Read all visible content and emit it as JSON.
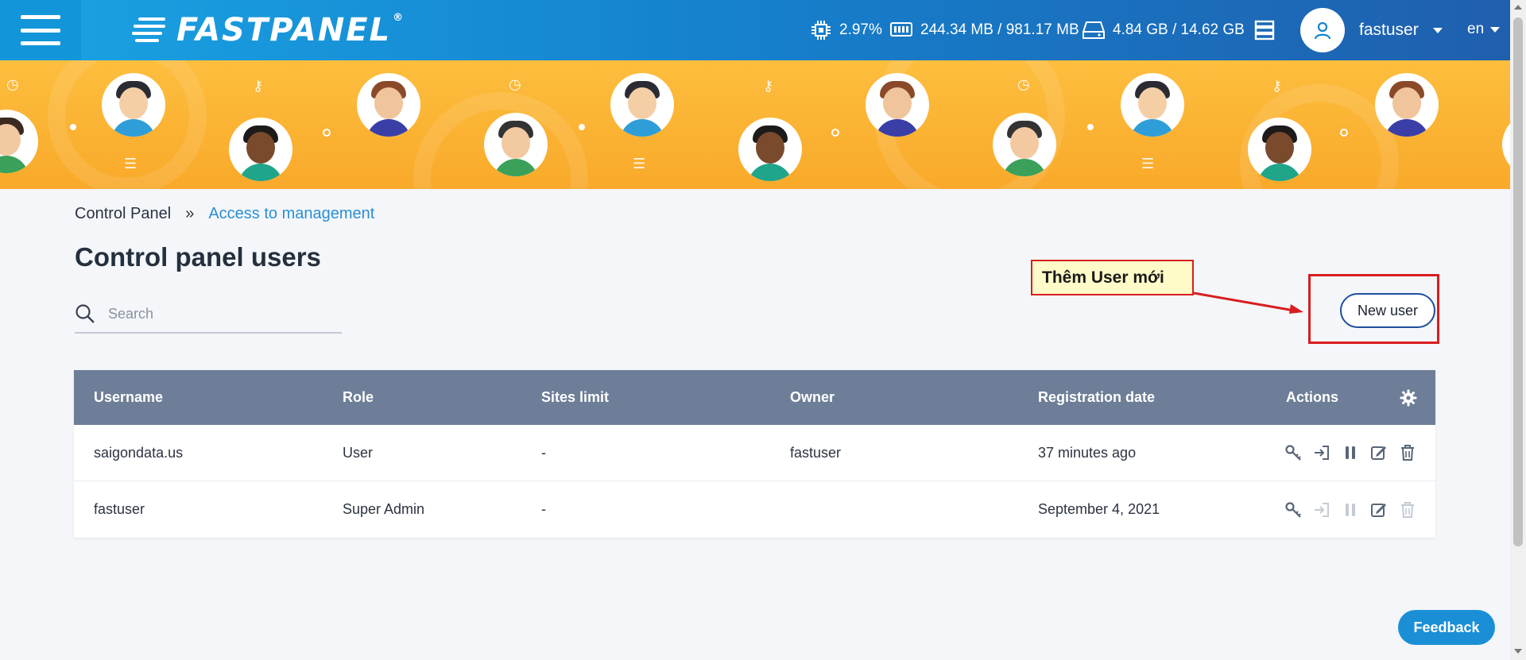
{
  "header": {
    "logo_text": "FASTPANEL",
    "logo_reg": "®",
    "cpu": "2.97%",
    "ram": "244.34 MB / 981.17 MB",
    "disk": "4.84 GB / 14.62 GB",
    "user_name": "fastuser",
    "language": "en"
  },
  "breadcrumb": {
    "root": "Control Panel",
    "separator": "»",
    "current": "Access to management"
  },
  "page_title": "Control panel users",
  "search": {
    "placeholder": "Search",
    "value": ""
  },
  "new_user_label": "New user",
  "annotation": {
    "callout_text": "Thêm User mới",
    "color": "#d81e1e"
  },
  "table": {
    "columns": [
      "Username",
      "Role",
      "Sites limit",
      "Owner",
      "Registration date",
      "Actions"
    ],
    "rows": [
      {
        "username": "saigondata.us",
        "role": "User",
        "sites_limit": "-",
        "owner": "fastuser",
        "registration_date": "37 minutes ago"
      },
      {
        "username": "fastuser",
        "role": "Super Admin",
        "sites_limit": "-",
        "owner": "",
        "registration_date": "September 4, 2021"
      }
    ]
  },
  "feedback_label": "Feedback",
  "icons": [
    "menu-icon",
    "cpu-icon",
    "ram-icon",
    "disk-icon",
    "server-icon",
    "user-icon",
    "search-icon",
    "gear-icon",
    "key-icon",
    "login-icon",
    "pause-icon",
    "edit-icon",
    "trash-icon"
  ],
  "colors": {
    "header": "#1583cf",
    "banner": "#fdbe3e",
    "table_header": "#6e7e98",
    "link": "#2a8fd4",
    "accent_button": "#1a8fd6"
  }
}
